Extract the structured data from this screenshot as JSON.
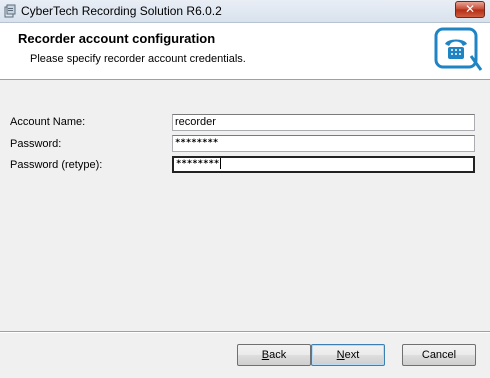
{
  "window": {
    "title": "CyberTech Recording Solution R6.0.2",
    "close_glyph": "✕"
  },
  "banner": {
    "title": "Recorder account configuration",
    "subtitle": "Please specify recorder account credentials.",
    "logo_icon": "telephone-logo-icon"
  },
  "form": {
    "account_name_label": "Account Name:",
    "account_name_value": "recorder",
    "password_label": "Password:",
    "password_value": "********",
    "password_retype_label": "Password (retype):",
    "password_retype_value": "********"
  },
  "buttons": {
    "back": {
      "mnemonic": "B",
      "rest": "ack"
    },
    "next": {
      "mnemonic": "N",
      "rest": "ext"
    },
    "cancel": "Cancel"
  },
  "colors": {
    "logo_blue": "#1f84c4",
    "close_red": "#c74a35"
  }
}
